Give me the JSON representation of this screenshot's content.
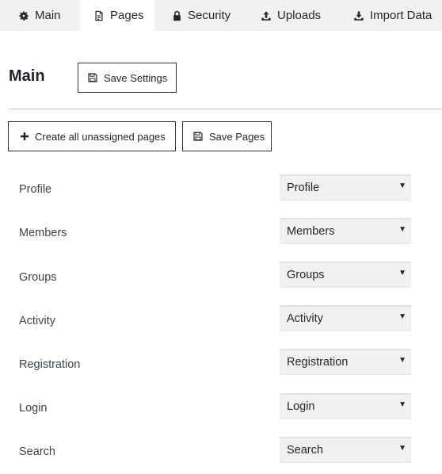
{
  "tabs": [
    {
      "label": "Main",
      "icon": "gear-icon",
      "active": false
    },
    {
      "label": "Pages",
      "icon": "document-icon",
      "active": true
    },
    {
      "label": "Security",
      "icon": "lock-icon",
      "active": false
    },
    {
      "label": "Uploads",
      "icon": "upload-icon",
      "active": false
    },
    {
      "label": "Import Data",
      "icon": "import-icon",
      "active": false
    }
  ],
  "header": {
    "title": "Main",
    "save_settings_label": "Save Settings"
  },
  "actions": {
    "create_pages_label": "Create all unassigned pages",
    "save_pages_label": "Save Pages"
  },
  "pages": [
    {
      "label": "Profile",
      "selected": "Profile"
    },
    {
      "label": "Members",
      "selected": "Members"
    },
    {
      "label": "Groups",
      "selected": "Groups"
    },
    {
      "label": "Activity",
      "selected": "Activity"
    },
    {
      "label": "Registration",
      "selected": "Registration"
    },
    {
      "label": "Login",
      "selected": "Login"
    },
    {
      "label": "Search",
      "selected": "Search"
    }
  ],
  "colors": {
    "tab_bar_bg": "#f1f1f1",
    "active_tab_bg": "#ffffff",
    "select_bg": "#f1f1f1",
    "button_border": "#2c3338"
  }
}
